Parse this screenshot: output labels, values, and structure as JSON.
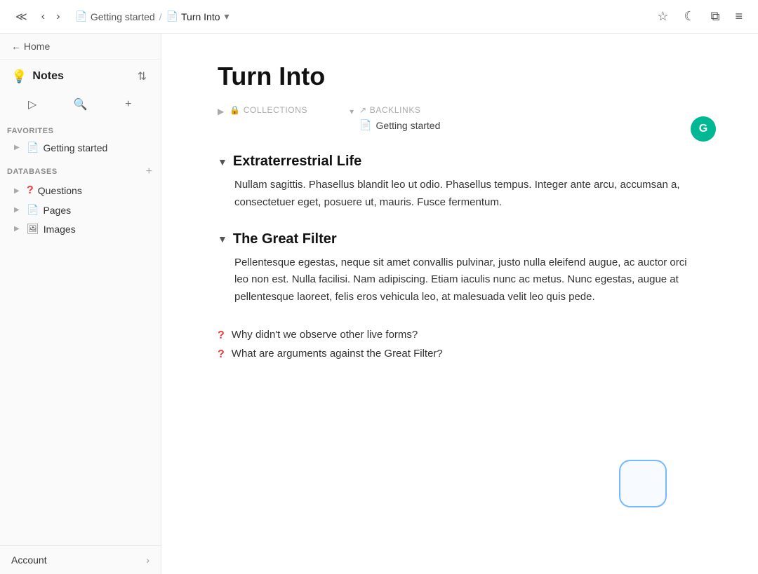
{
  "topbar": {
    "back_nav": "‹‹",
    "prev": "‹",
    "next": "›",
    "breadcrumb": [
      {
        "label": "Getting started",
        "icon": "📄"
      },
      {
        "label": "Turn Into",
        "icon": "📄",
        "active": true
      }
    ],
    "dropdown_arrow": "▾",
    "star_icon": "☆",
    "moon_icon": "☾",
    "windows_icon": "⧉",
    "menu_icon": "≡"
  },
  "sidebar": {
    "home_label": "← Home",
    "title": "Notes",
    "title_icon": "💡",
    "sort_icon": "⇅",
    "play_icon": "▷",
    "search_icon": "🔍",
    "add_icon": "+",
    "favorites_label": "FAVORITES",
    "databases_label": "DATABASES",
    "databases_add": "+",
    "favorites_items": [
      {
        "label": "Getting started",
        "icon": "📄",
        "toggle": "▶"
      }
    ],
    "databases_items": [
      {
        "label": "Questions",
        "icon": "?",
        "icon_type": "red",
        "toggle": "▶"
      },
      {
        "label": "Pages",
        "icon": "📄",
        "toggle": "▶"
      },
      {
        "label": "Images",
        "icon": "🖼",
        "toggle": "▶"
      }
    ],
    "account_label": "Account",
    "account_arrow": "›"
  },
  "content": {
    "page_title": "Turn Into",
    "avatar_initial": "G",
    "meta": {
      "collections_label": "COLLECTIONS",
      "collections_icon": "🔒",
      "collections_toggle": "▶",
      "backlinks_label": "BACKLINKS",
      "backlinks_icon": "↗",
      "backlinks_toggle": "▾",
      "backlinks_items": [
        {
          "label": "Getting started",
          "icon": "📄"
        }
      ]
    },
    "sections": [
      {
        "id": "extraterrestrial",
        "heading": "Extraterrestrial Life",
        "toggle": "▼",
        "body": "Nullam sagittis. Phasellus blandit leo ut odio. Phasellus tempus. Integer ante arcu, accumsan a, consectetuer eget, posuere ut, mauris. Fusce fermentum."
      },
      {
        "id": "great-filter",
        "heading": "The Great Filter",
        "toggle": "▼",
        "body": "Pellentesque egestas, neque sit amet convallis pulvinar, justo nulla eleifend augue, ac auctor orci leo non est. Nulla facilisi. Nam adipiscing. Etiam iaculis nunc ac metus. Nunc egestas, augue at pellentesque laoreet, felis eros vehicula leo, at malesuada velit leo quis pede."
      }
    ],
    "questions": [
      {
        "text": "Why didn't we observe other live forms?"
      },
      {
        "text": "What are arguments against the Great Filter?"
      }
    ],
    "question_icon": "?"
  }
}
